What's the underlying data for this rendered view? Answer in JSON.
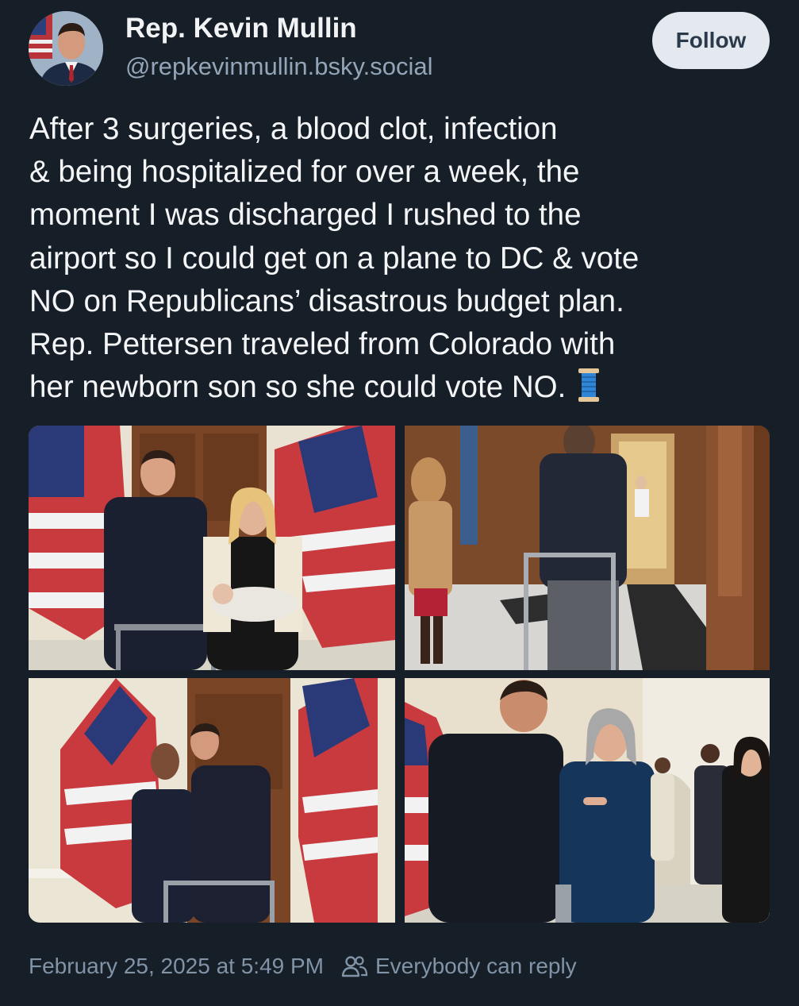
{
  "author": {
    "display_name": "Rep. Kevin Mullin",
    "handle": "@repkevinmullin.bsky.social",
    "avatar_icon": "avatar-photo"
  },
  "follow_label": "Follow",
  "post": {
    "lines": [
      "After 3 surgeries, a blood clot, infection",
      "& being hospitalized for over a week, the",
      "moment I was discharged I rushed to the",
      "airport so I could get on a plane to DC & vote",
      "NO on Republicans’ disastrous budget plan.",
      "Rep. Pettersen traveled from Colorado with",
      "her newborn son so she could vote NO."
    ],
    "emoji": "spool-of-thread-icon"
  },
  "images": [
    {
      "icon": "photo-flags-couple-baby"
    },
    {
      "icon": "photo-hallway-walker"
    },
    {
      "icon": "photo-flags-two-men"
    },
    {
      "icon": "photo-conversation-hallway"
    }
  ],
  "footer": {
    "timestamp": "February 25, 2025 at 5:49 PM",
    "reply_setting": "Everybody can reply"
  },
  "colors": {
    "background": "#161e27",
    "muted": "#8193a6",
    "button_bg": "#e3e9ef"
  }
}
